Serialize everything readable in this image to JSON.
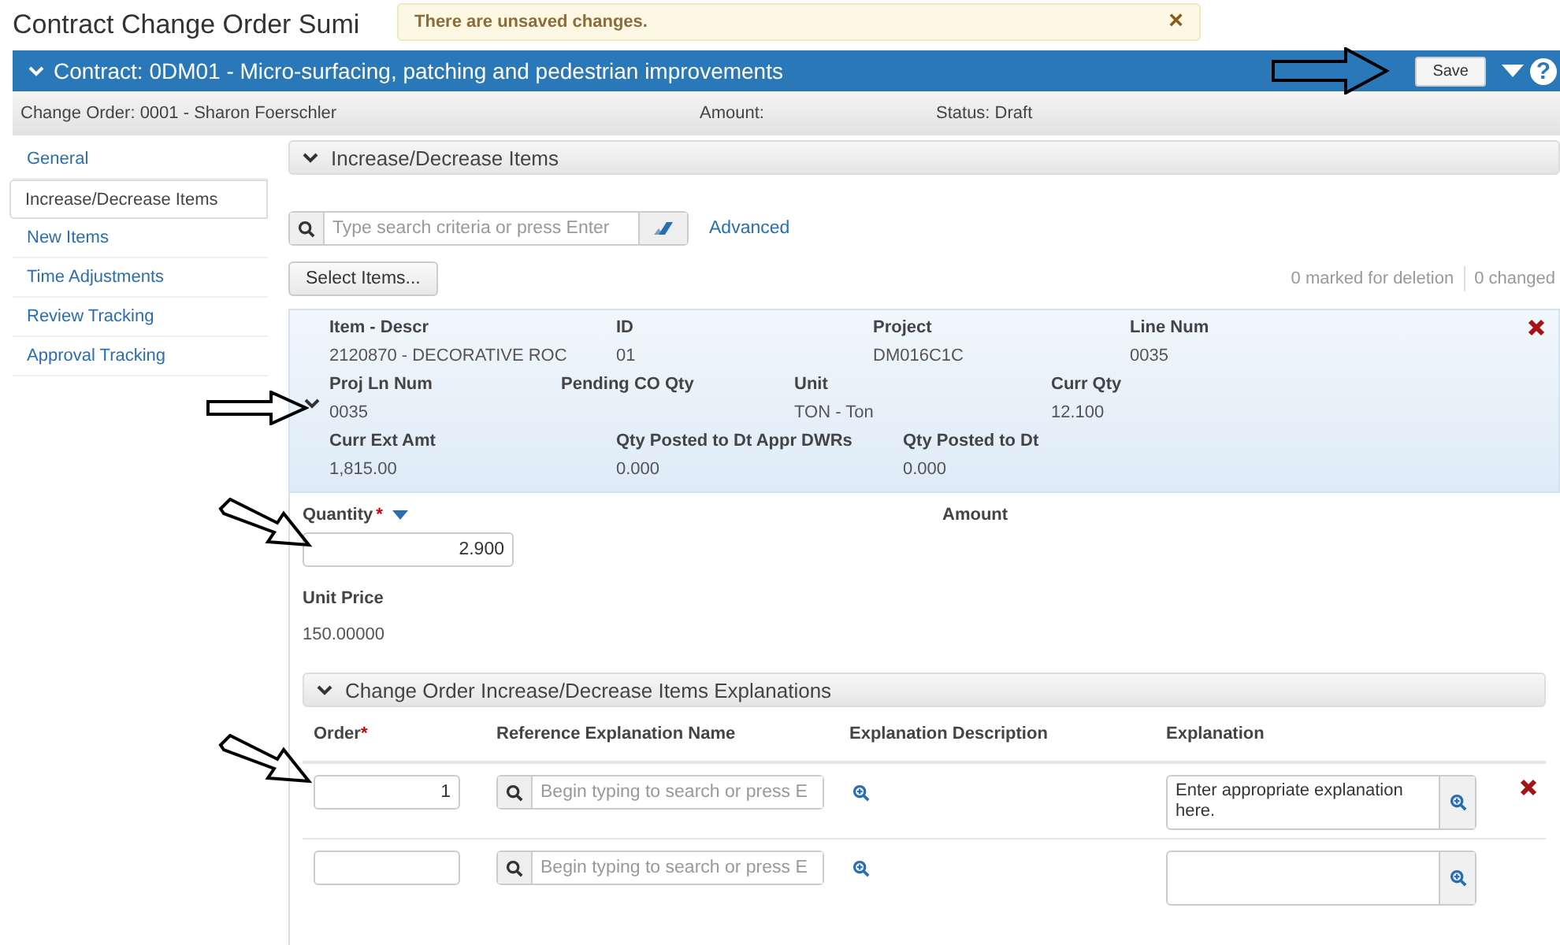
{
  "page_title": "Contract Change Order Sumi",
  "notification": {
    "message": "There are unsaved changes.",
    "close": "×"
  },
  "contract_bar": {
    "title": "Contract: 0DM01 - Micro-surfacing, patching and pedestrian improvements",
    "save": "Save",
    "help": "?"
  },
  "info_bar": {
    "change_order": "Change Order: 0001 - Sharon Foerschler",
    "amount": "Amount:",
    "status": "Status: Draft"
  },
  "sidebar": {
    "items": [
      {
        "label": "General",
        "selected": false
      },
      {
        "label": "Increase/Decrease Items",
        "selected": true
      },
      {
        "label": "New Items",
        "selected": false
      },
      {
        "label": "Time Adjustments",
        "selected": false
      },
      {
        "label": "Review Tracking",
        "selected": false
      },
      {
        "label": "Approval Tracking",
        "selected": false
      }
    ]
  },
  "section": {
    "title": "Increase/Decrease Items",
    "expanded": true
  },
  "search": {
    "placeholder": "Type search criteria or press Enter",
    "advanced": "Advanced"
  },
  "select_button": "Select Items...",
  "counts": [
    "0 marked for deletion",
    "0 changed"
  ],
  "item": {
    "expanded": true,
    "rows": [
      [
        {
          "label": "Item - Descr",
          "value": "2120870 - DECORATIVE ROC"
        },
        {
          "label": "ID",
          "value": "01"
        },
        {
          "label": "Project",
          "value": "DM016C1C"
        },
        {
          "label": "Line Num",
          "value": "0035"
        }
      ],
      [
        {
          "label": "Proj Ln Num",
          "value": "0035"
        },
        {
          "label": "Pending CO Qty"
        },
        {
          "label": "Unit",
          "value": "TON - Ton"
        },
        {
          "label": "Curr Qty",
          "value": "12.100"
        }
      ],
      [
        {
          "label": "Curr Ext Amt",
          "value": "1,815.00"
        },
        {
          "label": "Qty Posted to Dt Appr DWRs",
          "value": "0.000"
        },
        {
          "label": "Qty Posted to Dt",
          "value": "0.000"
        }
      ]
    ]
  },
  "quantity": {
    "label": "Quantity",
    "required_mark": "*",
    "value": "2.900"
  },
  "amount_label": "Amount",
  "unit_price": {
    "label": "Unit Price",
    "value": "150.00000"
  },
  "explanations": {
    "title": "Change Order Increase/Decrease Items Explanations",
    "expanded": true,
    "columns": [
      {
        "label": "Order",
        "required_mark": "*"
      },
      {
        "label": "Reference Explanation Name"
      },
      {
        "label": "Explanation Description"
      },
      {
        "label": "Explanation"
      }
    ],
    "rows": [
      {
        "order": "1",
        "reference_placeholder": "Begin typing to search or press E",
        "explanation": "Enter appropriate explanation here.",
        "deletable": true
      },
      {
        "order": "",
        "reference_placeholder": "Begin typing to search or press E",
        "explanation": "",
        "deletable": false
      }
    ]
  }
}
